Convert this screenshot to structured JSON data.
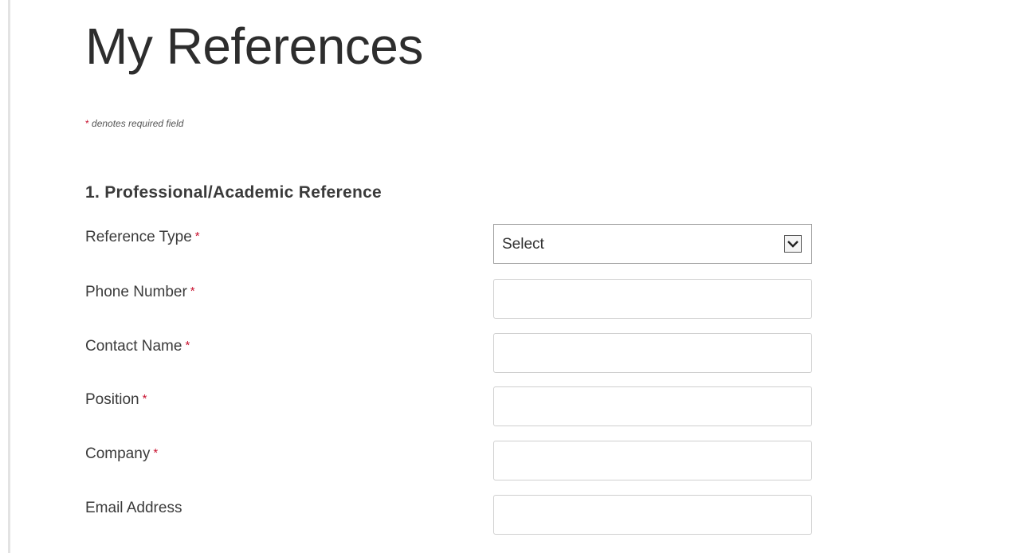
{
  "page": {
    "title": "My References",
    "required_note_marker": "*",
    "required_note_text": "denotes required field"
  },
  "section": {
    "heading": "1. Professional/Academic Reference"
  },
  "fields": [
    {
      "label": "Reference Type",
      "required": "*",
      "type": "select",
      "value": "Select"
    },
    {
      "label": "Phone Number",
      "required": "*",
      "type": "text",
      "value": ""
    },
    {
      "label": "Contact Name",
      "required": "*",
      "type": "text",
      "value": ""
    },
    {
      "label": "Position",
      "required": "*",
      "type": "text",
      "value": ""
    },
    {
      "label": "Company",
      "required": "*",
      "type": "text",
      "value": ""
    },
    {
      "label": "Email Address",
      "type": "text",
      "value": ""
    }
  ],
  "icons": {
    "dropdown": "chevron-down-icon"
  },
  "colors": {
    "required_star": "#c8102e",
    "text": "#333333",
    "input_border": "#cfcfcf"
  }
}
